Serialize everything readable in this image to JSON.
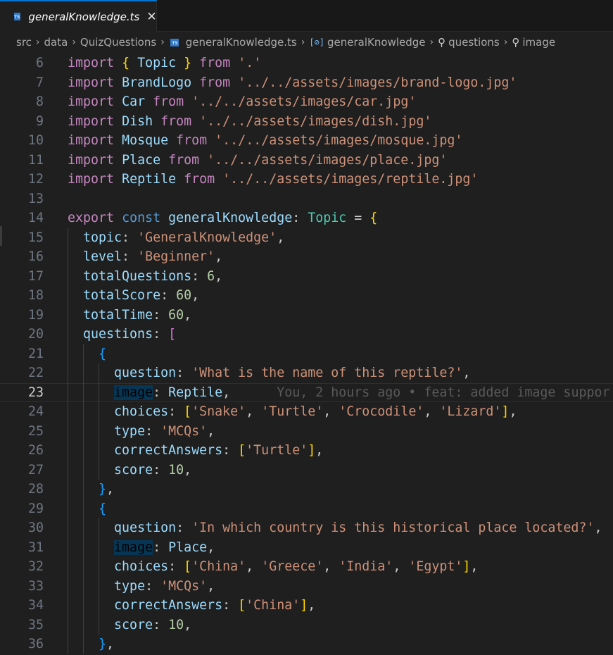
{
  "tab": {
    "label": "generalKnowledge.ts",
    "icon": "TS",
    "close": "✕"
  },
  "breadcrumb": [
    {
      "label": "src"
    },
    {
      "label": "data"
    },
    {
      "label": "QuizQuestions"
    },
    {
      "label": "generalKnowledge.ts",
      "icon": "ts-file-icon"
    },
    {
      "label": "generalKnowledge",
      "icon": "variable-icon"
    },
    {
      "label": "questions",
      "icon": "wrench-icon"
    },
    {
      "label": "image",
      "icon": "wrench-icon"
    }
  ],
  "colors": {
    "accent": "#0078d4",
    "background": "#1f1f1f",
    "keyword": "#c586c0",
    "string": "#ce9178",
    "variable": "#9cdcfe"
  },
  "editor": {
    "current_line": 23,
    "blame": "You, 2 hours ago • feat: added image suppor",
    "lines": [
      {
        "n": "6",
        "tokens": [
          [
            "kw",
            "import"
          ],
          [
            "p",
            " "
          ],
          [
            "b1",
            "{"
          ],
          [
            "p",
            " "
          ],
          [
            "var",
            "Topic"
          ],
          [
            "p",
            " "
          ],
          [
            "b1",
            "}"
          ],
          [
            "p",
            " "
          ],
          [
            "kw",
            "from"
          ],
          [
            "p",
            " "
          ],
          [
            "str",
            "'.'"
          ]
        ]
      },
      {
        "n": "7",
        "tokens": [
          [
            "kw",
            "import"
          ],
          [
            "p",
            " "
          ],
          [
            "var",
            "BrandLogo"
          ],
          [
            "p",
            " "
          ],
          [
            "kw",
            "from"
          ],
          [
            "p",
            " "
          ],
          [
            "str",
            "'../../assets/images/brand-logo.jpg'"
          ]
        ]
      },
      {
        "n": "8",
        "tokens": [
          [
            "kw",
            "import"
          ],
          [
            "p",
            " "
          ],
          [
            "var",
            "Car"
          ],
          [
            "p",
            " "
          ],
          [
            "kw",
            "from"
          ],
          [
            "p",
            " "
          ],
          [
            "str",
            "'../../assets/images/car.jpg'"
          ]
        ]
      },
      {
        "n": "9",
        "tokens": [
          [
            "kw",
            "import"
          ],
          [
            "p",
            " "
          ],
          [
            "var",
            "Dish"
          ],
          [
            "p",
            " "
          ],
          [
            "kw",
            "from"
          ],
          [
            "p",
            " "
          ],
          [
            "str",
            "'../../assets/images/dish.jpg'"
          ]
        ]
      },
      {
        "n": "10",
        "tokens": [
          [
            "kw",
            "import"
          ],
          [
            "p",
            " "
          ],
          [
            "var",
            "Mosque"
          ],
          [
            "p",
            " "
          ],
          [
            "kw",
            "from"
          ],
          [
            "p",
            " "
          ],
          [
            "str",
            "'../../assets/images/mosque.jpg'"
          ]
        ]
      },
      {
        "n": "11",
        "tokens": [
          [
            "kw",
            "import"
          ],
          [
            "p",
            " "
          ],
          [
            "var",
            "Place"
          ],
          [
            "p",
            " "
          ],
          [
            "kw",
            "from"
          ],
          [
            "p",
            " "
          ],
          [
            "str",
            "'../../assets/images/place.jpg'"
          ]
        ]
      },
      {
        "n": "12",
        "tokens": [
          [
            "kw",
            "import"
          ],
          [
            "p",
            " "
          ],
          [
            "var",
            "Reptile"
          ],
          [
            "p",
            " "
          ],
          [
            "kw",
            "from"
          ],
          [
            "p",
            " "
          ],
          [
            "str",
            "'../../assets/images/reptile.jpg'"
          ]
        ]
      },
      {
        "n": "13",
        "tokens": []
      },
      {
        "n": "14",
        "tokens": [
          [
            "kw",
            "export"
          ],
          [
            "p",
            " "
          ],
          [
            "kw2",
            "const"
          ],
          [
            "p",
            " "
          ],
          [
            "var",
            "generalKnowledge"
          ],
          [
            "p",
            ": "
          ],
          [
            "cls",
            "Topic"
          ],
          [
            "p",
            " = "
          ],
          [
            "b1",
            "{"
          ]
        ]
      },
      {
        "n": "15",
        "tokens": [
          [
            "p",
            "  "
          ],
          [
            "var",
            "topic"
          ],
          [
            "p",
            ": "
          ],
          [
            "str",
            "'GeneralKnowledge'"
          ],
          [
            "p",
            ","
          ]
        ]
      },
      {
        "n": "16",
        "tokens": [
          [
            "p",
            "  "
          ],
          [
            "var",
            "level"
          ],
          [
            "p",
            ": "
          ],
          [
            "str",
            "'Beginner'"
          ],
          [
            "p",
            ","
          ]
        ]
      },
      {
        "n": "17",
        "tokens": [
          [
            "p",
            "  "
          ],
          [
            "var",
            "totalQuestions"
          ],
          [
            "p",
            ": "
          ],
          [
            "num",
            "6"
          ],
          [
            "p",
            ","
          ]
        ]
      },
      {
        "n": "18",
        "tokens": [
          [
            "p",
            "  "
          ],
          [
            "var",
            "totalScore"
          ],
          [
            "p",
            ": "
          ],
          [
            "num",
            "60"
          ],
          [
            "p",
            ","
          ]
        ]
      },
      {
        "n": "19",
        "tokens": [
          [
            "p",
            "  "
          ],
          [
            "var",
            "totalTime"
          ],
          [
            "p",
            ": "
          ],
          [
            "num",
            "60"
          ],
          [
            "p",
            ","
          ]
        ]
      },
      {
        "n": "20",
        "tokens": [
          [
            "p",
            "  "
          ],
          [
            "var",
            "questions"
          ],
          [
            "p",
            ": "
          ],
          [
            "b2",
            "["
          ]
        ]
      },
      {
        "n": "21",
        "tokens": [
          [
            "p",
            "    "
          ],
          [
            "b3",
            "{"
          ]
        ]
      },
      {
        "n": "22",
        "tokens": [
          [
            "p",
            "      "
          ],
          [
            "var",
            "question"
          ],
          [
            "p",
            ": "
          ],
          [
            "str",
            "'What is the name of this reptile?'"
          ],
          [
            "p",
            ","
          ]
        ]
      },
      {
        "n": "23",
        "tokens": [
          [
            "p",
            "      "
          ],
          [
            "hl",
            "image"
          ],
          [
            "p",
            ": "
          ],
          [
            "var",
            "Reptile"
          ],
          [
            "p",
            ","
          ],
          [
            "p",
            "      "
          ],
          [
            "blame",
            "You, 2 hours ago • feat: added image suppor"
          ]
        ]
      },
      {
        "n": "24",
        "tokens": [
          [
            "p",
            "      "
          ],
          [
            "var",
            "choices"
          ],
          [
            "p",
            ": "
          ],
          [
            "b1",
            "["
          ],
          [
            "str",
            "'Snake'"
          ],
          [
            "p",
            ", "
          ],
          [
            "str",
            "'Turtle'"
          ],
          [
            "p",
            ", "
          ],
          [
            "str",
            "'Crocodile'"
          ],
          [
            "p",
            ", "
          ],
          [
            "str",
            "'Lizard'"
          ],
          [
            "b1",
            "]"
          ],
          [
            "p",
            ","
          ]
        ]
      },
      {
        "n": "25",
        "tokens": [
          [
            "p",
            "      "
          ],
          [
            "var",
            "type"
          ],
          [
            "p",
            ": "
          ],
          [
            "str",
            "'MCQs'"
          ],
          [
            "p",
            ","
          ]
        ]
      },
      {
        "n": "26",
        "tokens": [
          [
            "p",
            "      "
          ],
          [
            "var",
            "correctAnswers"
          ],
          [
            "p",
            ": "
          ],
          [
            "b1",
            "["
          ],
          [
            "str",
            "'Turtle'"
          ],
          [
            "b1",
            "]"
          ],
          [
            "p",
            ","
          ]
        ]
      },
      {
        "n": "27",
        "tokens": [
          [
            "p",
            "      "
          ],
          [
            "var",
            "score"
          ],
          [
            "p",
            ": "
          ],
          [
            "num",
            "10"
          ],
          [
            "p",
            ","
          ]
        ]
      },
      {
        "n": "28",
        "tokens": [
          [
            "p",
            "    "
          ],
          [
            "b3",
            "}"
          ],
          [
            "p",
            ","
          ]
        ]
      },
      {
        "n": "29",
        "tokens": [
          [
            "p",
            "    "
          ],
          [
            "b3",
            "{"
          ]
        ]
      },
      {
        "n": "30",
        "tokens": [
          [
            "p",
            "      "
          ],
          [
            "var",
            "question"
          ],
          [
            "p",
            ": "
          ],
          [
            "str",
            "'In which country is this historical place located?'"
          ],
          [
            "p",
            ","
          ]
        ]
      },
      {
        "n": "31",
        "tokens": [
          [
            "p",
            "      "
          ],
          [
            "hl",
            "image"
          ],
          [
            "p",
            ": "
          ],
          [
            "var",
            "Place"
          ],
          [
            "p",
            ","
          ]
        ]
      },
      {
        "n": "32",
        "tokens": [
          [
            "p",
            "      "
          ],
          [
            "var",
            "choices"
          ],
          [
            "p",
            ": "
          ],
          [
            "b1",
            "["
          ],
          [
            "str",
            "'China'"
          ],
          [
            "p",
            ", "
          ],
          [
            "str",
            "'Greece'"
          ],
          [
            "p",
            ", "
          ],
          [
            "str",
            "'India'"
          ],
          [
            "p",
            ", "
          ],
          [
            "str",
            "'Egypt'"
          ],
          [
            "b1",
            "]"
          ],
          [
            "p",
            ","
          ]
        ]
      },
      {
        "n": "33",
        "tokens": [
          [
            "p",
            "      "
          ],
          [
            "var",
            "type"
          ],
          [
            "p",
            ": "
          ],
          [
            "str",
            "'MCQs'"
          ],
          [
            "p",
            ","
          ]
        ]
      },
      {
        "n": "34",
        "tokens": [
          [
            "p",
            "      "
          ],
          [
            "var",
            "correctAnswers"
          ],
          [
            "p",
            ": "
          ],
          [
            "b1",
            "["
          ],
          [
            "str",
            "'China'"
          ],
          [
            "b1",
            "]"
          ],
          [
            "p",
            ","
          ]
        ]
      },
      {
        "n": "35",
        "tokens": [
          [
            "p",
            "      "
          ],
          [
            "var",
            "score"
          ],
          [
            "p",
            ": "
          ],
          [
            "num",
            "10"
          ],
          [
            "p",
            ","
          ]
        ]
      },
      {
        "n": "36",
        "tokens": [
          [
            "p",
            "    "
          ],
          [
            "b3",
            "}"
          ],
          [
            "p",
            ","
          ]
        ]
      }
    ]
  }
}
